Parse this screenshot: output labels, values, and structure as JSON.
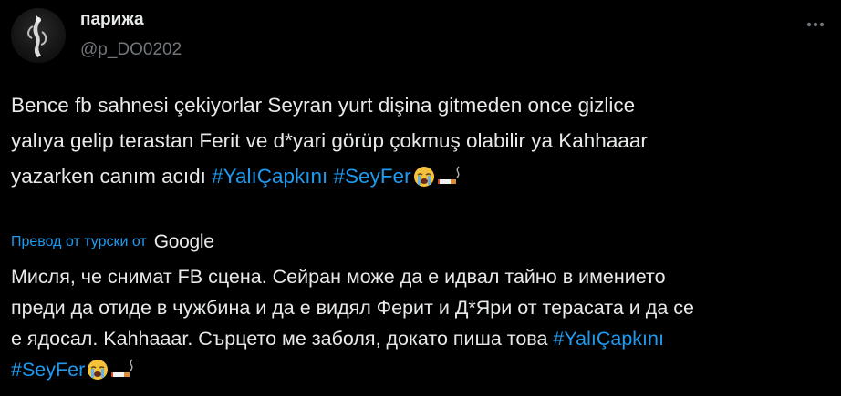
{
  "author": {
    "display_name": "парижа",
    "handle": "@p_DO0202"
  },
  "more_icon": "ellipsis-icon",
  "tweet": {
    "lines": [
      "Bence fb sahnesi çekiyorlar Seyran yurt dişina gitmeden once gizlice",
      "yalıya gelip terastan Ferit ve d*yari görüp çokmuş olabilir ya Kahhaaar"
    ],
    "line3_text": "yazarken canım acıdı ",
    "hashtag1": "#YalıÇapkını",
    "hashtag2": "#SeyFer",
    "emojis": [
      "loudly-crying-face",
      "cigarette"
    ]
  },
  "translation": {
    "label": "Превод от турски от",
    "provider": "Google",
    "lines": [
      "Мисля, че снимат FB сцена. Сейран може да е идвал тайно в имението",
      "преди да отиде в чужбина и да е видял Ферит и Д*Яри от терасата и да се"
    ],
    "line3_text": "е ядосал. Kahhaaar. Сърцето ме заболя, докато пиша това ",
    "hashtag1": "#YalıÇapkını",
    "hashtag2": "#SeyFer"
  },
  "colors": {
    "background": "#000000",
    "text": "#e7e9ea",
    "secondary": "#71767b",
    "accent": "#1d9bf0"
  }
}
